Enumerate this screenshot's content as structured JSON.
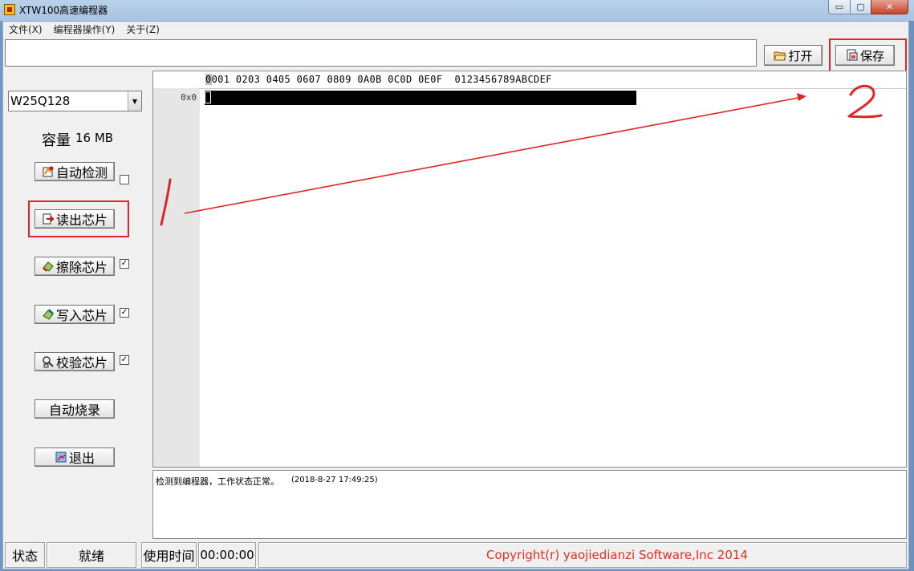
{
  "window": {
    "title": "XTW100高速编程器",
    "controls": {
      "minimize": "▭",
      "maximize": "▢",
      "close": "✕"
    }
  },
  "menu": [
    "文件(X)",
    "编程器操作(Y)",
    "关于(Z)"
  ],
  "toolbar": {
    "path_value": "",
    "open_label": "打开",
    "save_label": "保存"
  },
  "chip": {
    "selected": "W25Q128",
    "capacity_label": "容量",
    "capacity_value": "16 MB"
  },
  "actions": {
    "auto_detect": {
      "label": "自动检测",
      "checked": false
    },
    "read": {
      "label": "读出芯片"
    },
    "erase": {
      "label": "擦除芯片",
      "checked": true
    },
    "write": {
      "label": "写入芯片",
      "checked": true
    },
    "verify": {
      "label": "校验芯片",
      "checked": true
    },
    "auto_burn": {
      "label": "自动烧录"
    },
    "exit": {
      "label": "退出"
    }
  },
  "hex_editor": {
    "header": "0001 0203 0405 0607 0809 0A0B 0C0D 0E0F  0123456789ABCDEF",
    "rows": [
      {
        "offset": "0x0"
      }
    ]
  },
  "log": {
    "message": "检测到编程器，工作状态正常。",
    "timestamp": "(2018-8-27 17:49:25)"
  },
  "statusbar": {
    "status_label": "状态",
    "status_value": "就绪",
    "time_label": "使用时间",
    "time_value": "00:00:00",
    "copyright": "Copyright(r) yaojiedianzi Software,Inc 2014"
  },
  "annotations": {
    "marker_1": "1",
    "marker_2": "2",
    "color": "#e02525"
  },
  "colors": {
    "copyright": "#e0301e",
    "annotation": "#e02525"
  }
}
